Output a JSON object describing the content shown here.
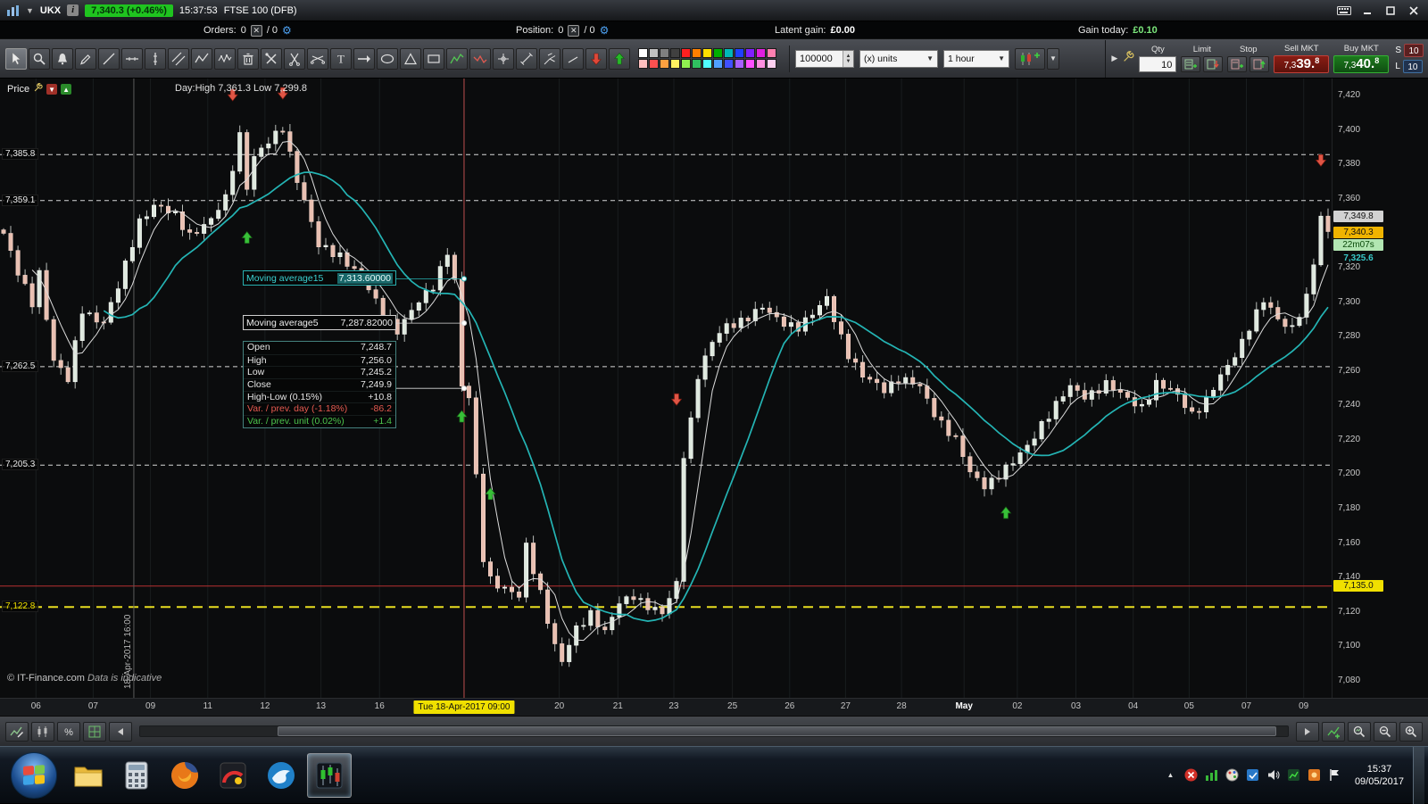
{
  "title_bar": {
    "symbol": "UKX",
    "info": "i",
    "price_badge": "7,340.3 (+0.46%)",
    "clock": "15:37:53",
    "instrument": "FTSE 100 (DFB)"
  },
  "orders_bar": {
    "orders_label": "Orders:",
    "orders_count": "0",
    "orders_alt": "/ 0",
    "position_label": "Position:",
    "position_count": "0",
    "position_alt": "/ 0",
    "latent_gain_label": "Latent gain:",
    "latent_gain_value": "£0.00",
    "gain_today_label": "Gain today:",
    "gain_today_value": "£0.10"
  },
  "toolbar": {
    "tools": [
      "pointer",
      "zoom",
      "bell",
      "pencil",
      "line",
      "hline",
      "vline",
      "channel",
      "zigzag",
      "wave",
      "trash",
      "tools",
      "cut",
      "cut2",
      "text",
      "arrow-right",
      "ellipse",
      "triangle",
      "rect",
      "pattern-up",
      "pattern-down",
      "cross-cursor",
      "measure",
      "fork",
      "sline",
      "sell-signal",
      "buy-signal"
    ],
    "palette_row1": [
      "#ffffff",
      "#c0c0c0",
      "#808080",
      "#404040",
      "#ff2020",
      "#ff8000",
      "#ffe000",
      "#00b000",
      "#00b8b8",
      "#2040ff",
      "#8020ff",
      "#e020e0",
      "#ff80b0"
    ],
    "palette_row2": [
      "#ffc0c0",
      "#ff5050",
      "#ffa040",
      "#fff060",
      "#90f050",
      "#30c060",
      "#50ffff",
      "#50a0ff",
      "#4050ff",
      "#a860ff",
      "#ff50ff",
      "#ff90e0",
      "#ffd0f0"
    ],
    "qty_input": "100000",
    "units_select": "(x) units",
    "timeframe_select": "1 hour",
    "trade": {
      "qty_label": "Qty",
      "qty_value": "10",
      "limit_label": "Limit",
      "stop_label": "Stop",
      "sell_label": "Sell MKT",
      "buy_label": "Buy MKT",
      "sell_pre": "7,3",
      "sell_mid": "39.",
      "sell_sup": "8",
      "buy_pre": "7,3",
      "buy_mid": "40.",
      "buy_sup": "8",
      "s_label": "S",
      "s_value": "10",
      "l_label": "L",
      "l_value": "10"
    }
  },
  "chart": {
    "pane_label": "Price",
    "day_stats": "Day:High 7,361.3 Low 7,299.8",
    "copyright": "© IT-Finance.com",
    "disclaimer": "Data is indicative",
    "vline_label": "18-Apr-2017 16:00",
    "crosshair_label": "Tue 18-Apr-2017 09:00",
    "crosshair_pct": 0.3485,
    "gray_vline_pct": 0.1005,
    "ma15_label": "Moving average15",
    "ma15_value": "7,313.60000",
    "ma5_label": "Moving average5",
    "ma5_value": "7,287.82000",
    "databox_rows": [
      {
        "label": "Open",
        "value": "7,248.7",
        "color": "#e6e6e6"
      },
      {
        "label": "High",
        "value": "7,256.0",
        "color": "#e6e6e6"
      },
      {
        "label": "Low",
        "value": "7,245.2",
        "color": "#e6e6e6"
      },
      {
        "label": "Close",
        "value": "7,249.9",
        "color": "#e6e6e6"
      },
      {
        "label": "High-Low (0.15%)",
        "value": "+10.8",
        "color": "#e6e6e6"
      },
      {
        "label": "Var. / prev. day (-1.18%)",
        "value": "-86.2",
        "color": "#e65a50"
      },
      {
        "label": "Var. / prev. unit (0.02%)",
        "value": "+1.4",
        "color": "#4cc44c"
      }
    ],
    "left_levels": [
      {
        "text": "7,385.8",
        "color": "#e8e8e8"
      },
      {
        "text": "7,359.1",
        "color": "#e8e8e8"
      },
      {
        "text": "7,262.5",
        "color": "#e8e8e8"
      },
      {
        "text": "7,205.3",
        "color": "#e8e8e8"
      },
      {
        "text": "7,122.8",
        "color": "#f0e000"
      }
    ],
    "badges": [
      {
        "text": "7,349.8",
        "price": 7349.8,
        "bg": "#d2d2d2",
        "fg": "#111"
      },
      {
        "text": "7,340.3",
        "price": 7340.3,
        "bg": "#f0b400",
        "fg": "#111"
      },
      {
        "text": "22m07s",
        "price": 7333.5,
        "bg": "#b2e6b2",
        "fg": "#0a4a0a"
      },
      {
        "text": "7,325.6",
        "price": 7325.6,
        "bg": "",
        "fg": "#38c8c8"
      },
      {
        "text": "7,135.0",
        "price": 7135.0,
        "bg": "#f0e000",
        "fg": "#111"
      }
    ],
    "y_ticks": [
      "7,420",
      "7,400",
      "7,380",
      "7,360",
      "7,340",
      "7,320",
      "7,300",
      "7,280",
      "7,260",
      "7,240",
      "7,220",
      "7,200",
      "7,180",
      "7,160",
      "7,140",
      "7,120",
      "7,100",
      "7,080"
    ],
    "x_ticks": [
      {
        "label": "06",
        "pct": 0.027
      },
      {
        "label": "07",
        "pct": 0.07
      },
      {
        "label": "09",
        "pct": 0.113
      },
      {
        "label": "11",
        "pct": 0.156
      },
      {
        "label": "12",
        "pct": 0.199
      },
      {
        "label": "13",
        "pct": 0.241
      },
      {
        "label": "16",
        "pct": 0.285
      },
      {
        "label": "20",
        "pct": 0.42
      },
      {
        "label": "21",
        "pct": 0.464
      },
      {
        "label": "23",
        "pct": 0.506
      },
      {
        "label": "25",
        "pct": 0.55
      },
      {
        "label": "26",
        "pct": 0.593
      },
      {
        "label": "27",
        "pct": 0.635
      },
      {
        "label": "28",
        "pct": 0.677
      },
      {
        "label": "May",
        "pct": 0.724,
        "bold": true
      },
      {
        "label": "02",
        "pct": 0.764
      },
      {
        "label": "03",
        "pct": 0.808
      },
      {
        "label": "04",
        "pct": 0.851
      },
      {
        "label": "05",
        "pct": 0.893
      },
      {
        "label": "07",
        "pct": 0.936
      },
      {
        "label": "09",
        "pct": 0.979
      }
    ]
  },
  "chart_data": {
    "type": "candlestick",
    "symbol": "UKX FTSE 100 (DFB)",
    "timeframe": "1 hour",
    "price_top": 7430,
    "price_bottom": 7070,
    "num_candles": 186,
    "price_anchors": [
      [
        0,
        7340
      ],
      [
        2,
        7316
      ],
      [
        4,
        7300
      ],
      [
        5,
        7318
      ],
      [
        7,
        7266
      ],
      [
        9,
        7254
      ],
      [
        11,
        7296
      ],
      [
        14,
        7288
      ],
      [
        16,
        7308
      ],
      [
        19,
        7348
      ],
      [
        21,
        7356
      ],
      [
        24,
        7350
      ],
      [
        26,
        7340
      ],
      [
        29,
        7347
      ],
      [
        31,
        7360
      ],
      [
        33,
        7398
      ],
      [
        34,
        7368
      ],
      [
        35,
        7384
      ],
      [
        37,
        7392
      ],
      [
        39,
        7402
      ],
      [
        41,
        7372
      ],
      [
        44,
        7332
      ],
      [
        47,
        7328
      ],
      [
        50,
        7314
      ],
      [
        52,
        7300
      ],
      [
        55,
        7284
      ],
      [
        57,
        7294
      ],
      [
        60,
        7310
      ],
      [
        62,
        7330
      ],
      [
        63,
        7312
      ],
      [
        64,
        7250
      ],
      [
        65,
        7244
      ],
      [
        66,
        7198
      ],
      [
        67,
        7152
      ],
      [
        68,
        7140
      ],
      [
        70,
        7133
      ],
      [
        72,
        7128
      ],
      [
        73,
        7158
      ],
      [
        75,
        7132
      ],
      [
        77,
        7100
      ],
      [
        78,
        7090
      ],
      [
        80,
        7110
      ],
      [
        82,
        7120
      ],
      [
        84,
        7108
      ],
      [
        86,
        7124
      ],
      [
        88,
        7130
      ],
      [
        90,
        7124
      ],
      [
        92,
        7118
      ],
      [
        94,
        7136
      ],
      [
        95,
        7212
      ],
      [
        96,
        7232
      ],
      [
        97,
        7258
      ],
      [
        99,
        7276
      ],
      [
        101,
        7286
      ],
      [
        103,
        7290
      ],
      [
        106,
        7296
      ],
      [
        108,
        7290
      ],
      [
        111,
        7286
      ],
      [
        113,
        7292
      ],
      [
        115,
        7302
      ],
      [
        118,
        7270
      ],
      [
        120,
        7256
      ],
      [
        123,
        7250
      ],
      [
        125,
        7256
      ],
      [
        128,
        7250
      ],
      [
        130,
        7236
      ],
      [
        133,
        7220
      ],
      [
        135,
        7200
      ],
      [
        137,
        7194
      ],
      [
        139,
        7200
      ],
      [
        141,
        7206
      ],
      [
        143,
        7216
      ],
      [
        145,
        7230
      ],
      [
        147,
        7240
      ],
      [
        149,
        7250
      ],
      [
        151,
        7246
      ],
      [
        154,
        7252
      ],
      [
        156,
        7246
      ],
      [
        159,
        7240
      ],
      [
        161,
        7252
      ],
      [
        164,
        7246
      ],
      [
        166,
        7236
      ],
      [
        168,
        7242
      ],
      [
        170,
        7256
      ],
      [
        172,
        7270
      ],
      [
        174,
        7286
      ],
      [
        176,
        7300
      ],
      [
        178,
        7290
      ],
      [
        180,
        7286
      ],
      [
        182,
        7302
      ],
      [
        183,
        7322
      ],
      [
        184,
        7348
      ],
      [
        185,
        7341
      ]
    ],
    "levels_dashed": [
      7385.8,
      7359.1,
      7262.5,
      7205.3
    ],
    "level_yellow": 7122.8,
    "level_red": 7135.0,
    "crosshair_ma15": 7313.6,
    "crosshair_ma5": 7287.82,
    "crosshair_close": 7249.9,
    "signals": [
      {
        "i": 32,
        "dir": "down",
        "price": 7417
      },
      {
        "i": 34,
        "dir": "up",
        "price": 7341
      },
      {
        "i": 39,
        "dir": "down",
        "price": 7418
      },
      {
        "i": 64,
        "dir": "up",
        "price": 7237
      },
      {
        "i": 68,
        "dir": "up",
        "price": 7192
      },
      {
        "i": 94,
        "dir": "down",
        "price": 7240
      },
      {
        "i": 140,
        "dir": "up",
        "price": 7181
      },
      {
        "i": 184,
        "dir": "down",
        "price": 7379
      }
    ],
    "moving_averages": [
      {
        "period": 5,
        "color": "#dcdcdc",
        "label": "Moving average5"
      },
      {
        "period": 15,
        "color": "#24b4b4",
        "label": "Moving average15"
      }
    ]
  },
  "taskbar": {
    "time": "15:37",
    "date": "09/05/2017",
    "apps": [
      {
        "name": "explorer"
      },
      {
        "name": "calculator"
      },
      {
        "name": "firefox"
      },
      {
        "name": "app-dark"
      },
      {
        "name": "bird-blue"
      },
      {
        "name": "trading",
        "active": true
      }
    ],
    "tray": [
      "tray-expand",
      "tray-red",
      "tray-green",
      "tray-paint",
      "tray-blue",
      "tray-audio",
      "tray-chart",
      "tray-orange",
      "tray-flag"
    ]
  }
}
